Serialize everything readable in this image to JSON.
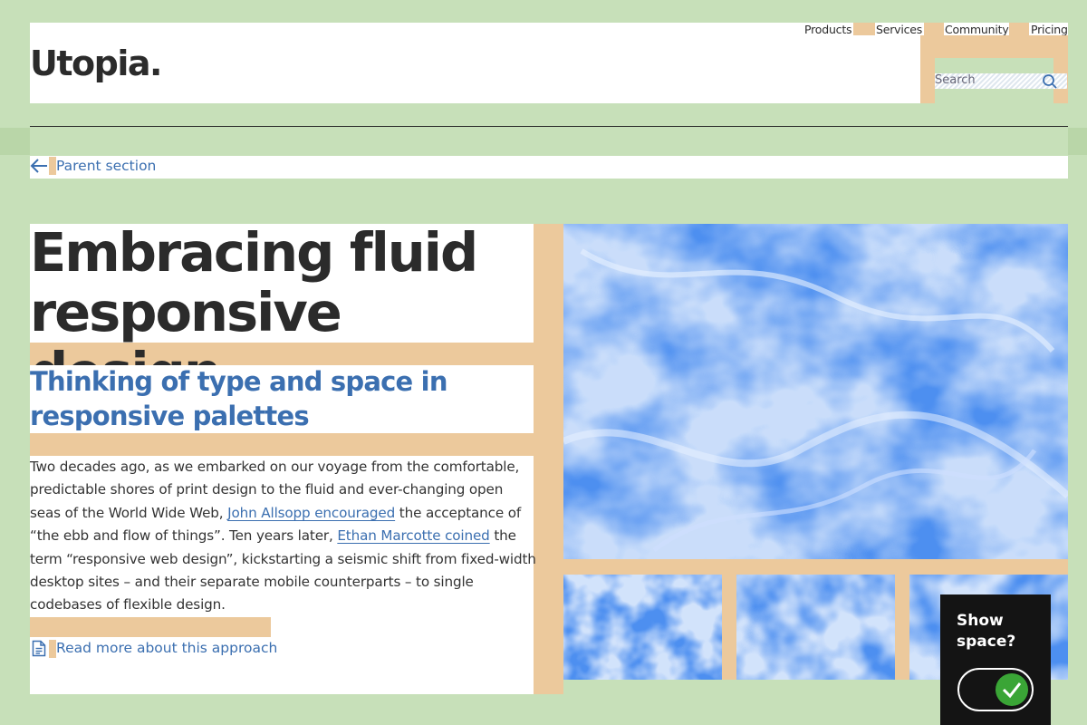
{
  "header": {
    "logo": "Utopia.",
    "nav": [
      "Products",
      "Services",
      "Community",
      "Pricing"
    ],
    "search_placeholder": "Search"
  },
  "breadcrumb": {
    "label": "Parent section"
  },
  "article": {
    "title": "Embracing fluid responsive design",
    "subtitle": "Thinking of type and space in responsive palettes",
    "body": {
      "part1": "Two decades ago, as we embarked on our voyage from the comfortable, predictable shores of print design to the fluid and ever-changing open seas of the World Wide Web, ",
      "link1": "John Allsopp encouraged",
      "part2": " the acceptance of “the ebb and flow of things”. Ten years later, ",
      "link2": "Ethan Marcotte coined",
      "part3": " the term “responsive web design”, kickstarting a seismic shift from fixed-width desktop sites – and their separate mobile counterparts – to single codebases of flexible design."
    },
    "read_more": "Read more about this approach"
  },
  "toggle": {
    "label": "Show space?",
    "state": "on"
  },
  "colors": {
    "background": "#c7e0b9",
    "space": "#ecc99c",
    "accent": "#3b6fb0",
    "text": "#2b2b2b",
    "toggle_on": "#3aa536"
  },
  "icons": {
    "search": "search-icon",
    "back": "arrow-left-icon",
    "document": "document-icon",
    "check": "check-icon"
  }
}
